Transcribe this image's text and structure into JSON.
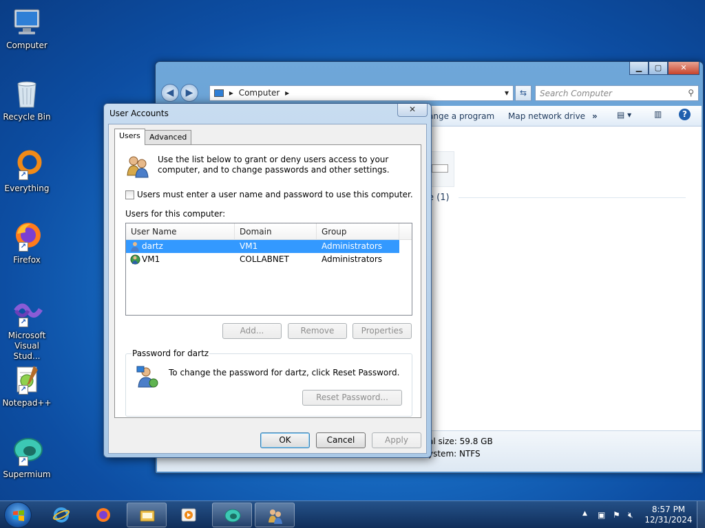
{
  "desktop": {
    "icons": [
      {
        "label": "Computer",
        "icon": "computer-icon"
      },
      {
        "label": "Recycle Bin",
        "icon": "recycle-bin-icon"
      },
      {
        "label": "Everything",
        "icon": "everything-icon"
      },
      {
        "label": "Firefox",
        "icon": "firefox-icon"
      },
      {
        "label_line1": "Microsoft",
        "label_line2": "Visual Stud...",
        "icon": "visual-studio-icon"
      },
      {
        "label": "Notepad++",
        "icon": "notepadpp-icon"
      },
      {
        "label": "Supermium",
        "icon": "supermium-icon"
      }
    ]
  },
  "explorer": {
    "address": "Computer",
    "search_placeholder": "Search Computer",
    "toolbar": {
      "uninstall": "ange a program",
      "map_drive": "Map network drive",
      "more": "»"
    },
    "content": {
      "section_fragment": "e (1)",
      "total_size": "al size: 59.8 GB",
      "file_system": "ystem: NTFS"
    }
  },
  "dialog": {
    "title": "User Accounts",
    "close_glyph": "✕",
    "tabs": [
      "Users",
      "Advanced"
    ],
    "intro": "Use the list below to grant or deny users access to your computer, and to change passwords and other settings.",
    "checkbox_label": "Users must enter a user name and password to use this computer.",
    "checkbox_checked": false,
    "users_label": "Users for this computer:",
    "columns": [
      "User Name",
      "Domain",
      "Group"
    ],
    "rows": [
      {
        "user": "dartz",
        "domain": "VM1",
        "group": "Administrators",
        "selected": true
      },
      {
        "user": "VM1",
        "domain": "COLLABNET",
        "group": "Administrators",
        "selected": false
      }
    ],
    "buttons": {
      "add": "Add...",
      "remove": "Remove",
      "properties": "Properties",
      "reset_password": "Reset Password...",
      "ok": "OK",
      "cancel": "Cancel",
      "apply": "Apply"
    },
    "password_group_title": "Password for dartz",
    "password_text": "To change the password for dartz, click Reset Password."
  },
  "taskbar": {
    "clock_time": "8:57 PM",
    "clock_date": "12/31/2024",
    "tray_expand": "▲"
  },
  "colors": {
    "selection": "#3399ff",
    "desktop_blue": "#1a72c9"
  }
}
